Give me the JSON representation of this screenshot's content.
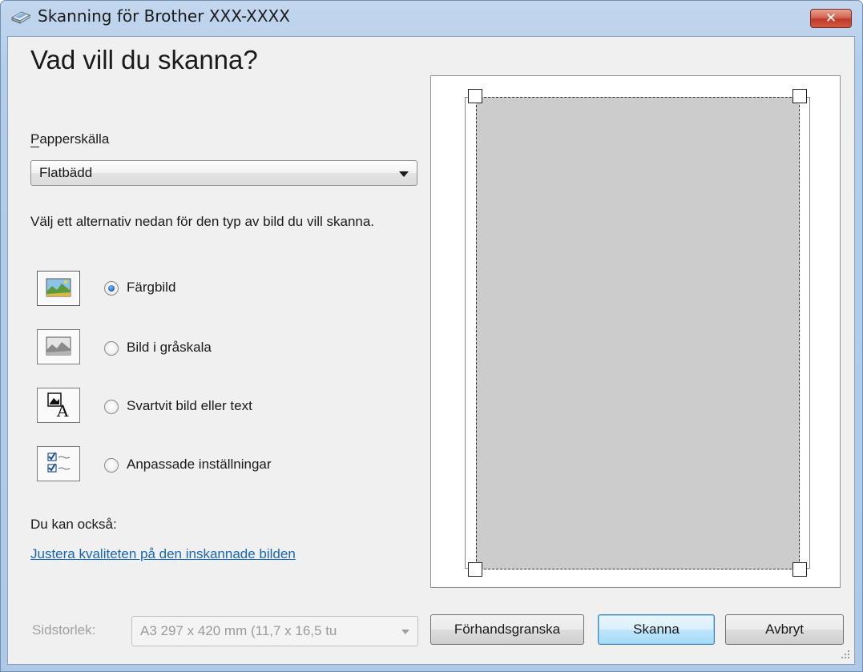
{
  "window": {
    "title": "Skanning för Brother XXX-XXXX",
    "close_label": "✕"
  },
  "main": {
    "heading": "Vad vill du skanna?",
    "paper_source_label": "Papperskälla",
    "paper_source_value": "Flatbädd",
    "instruction": "Välj ett alternativ nedan för den typ av bild du vill skanna.",
    "options": [
      {
        "label": "Färgbild",
        "selected": true,
        "icon": "color-picture-icon"
      },
      {
        "label": "Bild i gråskala",
        "selected": false,
        "icon": "grayscale-picture-icon"
      },
      {
        "label": "Svartvit bild eller text",
        "selected": false,
        "icon": "black-white-text-icon"
      },
      {
        "label": "Anpassade inställningar",
        "selected": false,
        "icon": "custom-settings-icon"
      }
    ],
    "also_label": "Du kan också:",
    "adjust_link": "Justera kvaliteten på den inskannade bilden"
  },
  "footer": {
    "page_size_label": "Sidstorlek:",
    "page_size_value": "A3 297 x 420 mm (11,7 x 16,5 tu",
    "preview_button": "Förhandsgranska",
    "scan_button": "Skanna",
    "cancel_button": "Avbryt"
  },
  "colors": {
    "accent_link": "#1767b7",
    "scan_area": "#cccccc",
    "radio_selected": "#1b63c6"
  }
}
